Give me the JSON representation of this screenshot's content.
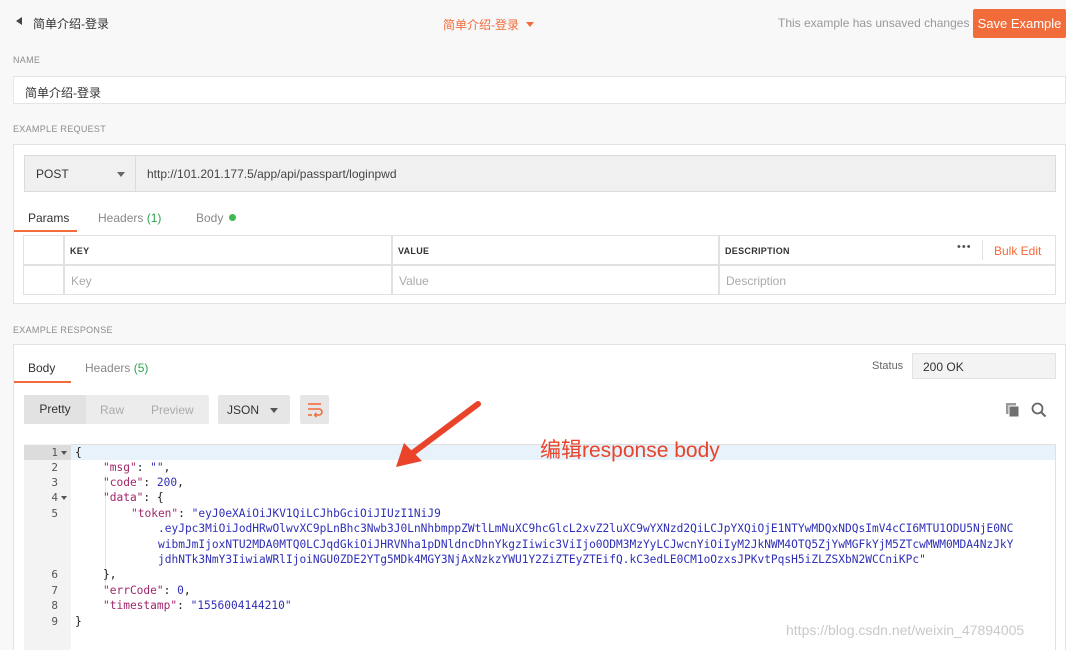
{
  "header": {
    "back_title": "简单介绍-登录",
    "center_title": "简单介绍-登录",
    "unsaved_text": "This example has unsaved changes",
    "save_label": "Save Example"
  },
  "name_section": {
    "label": "NAME",
    "value": "简单介绍-登录"
  },
  "request": {
    "label": "EXAMPLE REQUEST",
    "method": "POST",
    "url": "http://101.201.177.5/app/api/passpart/loginpwd",
    "tabs": {
      "params": "Params",
      "headers": "Headers",
      "headers_count": "(1)",
      "body": "Body"
    },
    "table": {
      "key_header": "KEY",
      "value_header": "VALUE",
      "description_header": "DESCRIPTION",
      "more": "•••",
      "bulk_edit": "Bulk Edit",
      "key_placeholder": "Key",
      "value_placeholder": "Value",
      "description_placeholder": "Description"
    }
  },
  "response": {
    "label": "EXAMPLE RESPONSE",
    "tabs": {
      "body": "Body",
      "headers": "Headers",
      "headers_count": "(5)"
    },
    "status_label": "Status",
    "status_value": "200 OK",
    "view_modes": [
      "Pretty",
      "Raw",
      "Preview"
    ],
    "format": "JSON",
    "code_lines": [
      {
        "no": "1",
        "text": "{"
      },
      {
        "no": "2",
        "key": "\"msg\"",
        "rest": ": ",
        "val": "\"\"",
        "end": ","
      },
      {
        "no": "3",
        "key": "\"code\"",
        "rest": ": ",
        "val": "200",
        "end": ","
      },
      {
        "no": "4",
        "key": "\"data\"",
        "rest": ": {",
        "val": "",
        "end": ""
      },
      {
        "no": "5",
        "key": "\"token\"",
        "rest": ": ",
        "val": "\"eyJ0eXAiOiJKV1QiLCJhbGciOiJIUzI1NiJ9",
        "end": ""
      },
      {
        "no": "",
        "text": ".eyJpc3MiOiJodHRwOlwvXC9pLnBhc3Nwb3J0LnNhbmppZWtlLmNuXC9hcGlcL2xvZ2luXC9wYXNzd2QiLCJpYXQiOjE1NTYwMDQxNDQsImV4cCI6MTU1ODU5NjE0NC"
      },
      {
        "no": "",
        "text": "wibmJmIjoxNTU2MDA0MTQ0LCJqdGkiOiJHRVNha1pDNldncDhnYkgzIiwic3ViIjo0ODM3MzYyLCJwcnYiOiIyM2JkNWM4OTQ5ZjYwMGFkYjM5ZTcwMWM0MDA4NzJkY"
      },
      {
        "no": "",
        "text": "jdhNTk3NmY3IiwiaWRlIjoiNGU0ZDE2YTg5MDk4MGY3NjAxNzkzYWU1Y2ZiZTEyZTEifQ.kC3edLE0CM1oOzxsJPKvtPqsH5iZLZSXbN2WCCniKPc\""
      },
      {
        "no": "6",
        "text": "},"
      },
      {
        "no": "7",
        "key": "\"errCode\"",
        "rest": ": ",
        "val": "0",
        "end": ","
      },
      {
        "no": "8",
        "key": "\"timestamp\"",
        "rest": ": ",
        "val": "\"1556004144210\"",
        "end": ""
      },
      {
        "no": "9",
        "text": "}"
      }
    ]
  },
  "annotation": "编辑response body",
  "watermark": "https://blog.csdn.net/weixin_47894005",
  "colors": {
    "accent": "#f26b3a",
    "annotation": "#e9442a",
    "json_key": "#a0276b",
    "json_value": "#2f2fb8"
  }
}
